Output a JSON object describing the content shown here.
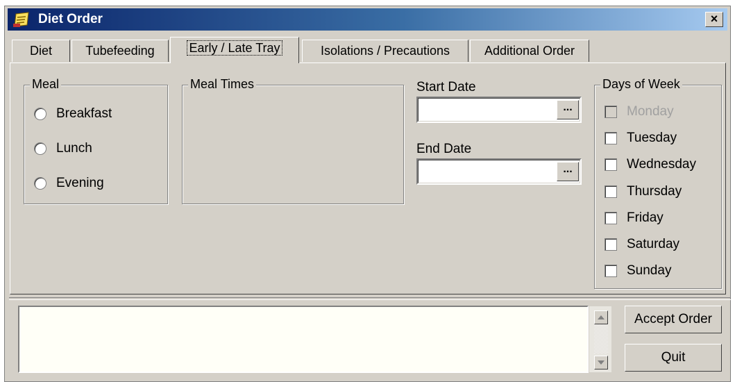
{
  "window": {
    "title": "Diet Order",
    "title_icon": "notepad-icon",
    "close_label": "×"
  },
  "tabs": [
    {
      "label": "Diet"
    },
    {
      "label": "Tubefeeding"
    },
    {
      "label": "Early / Late Tray"
    },
    {
      "label": "Isolations / Precautions"
    },
    {
      "label": "Additional Order"
    }
  ],
  "active_tab": "Early / Late Tray",
  "meal": {
    "legend": "Meal",
    "options": [
      {
        "label": "Breakfast",
        "selected": false
      },
      {
        "label": "Lunch",
        "selected": false
      },
      {
        "label": "Evening",
        "selected": false
      }
    ]
  },
  "meal_times": {
    "legend": "Meal Times"
  },
  "dates": {
    "start_label": "Start Date",
    "start_value": "",
    "end_label": "End Date",
    "end_value": "",
    "picker_label": "..."
  },
  "days_of_week": {
    "legend": "Days of Week",
    "days": [
      {
        "label": "Monday",
        "checked": false,
        "disabled": true
      },
      {
        "label": "Tuesday",
        "checked": false,
        "disabled": false
      },
      {
        "label": "Wednesday",
        "checked": false,
        "disabled": false
      },
      {
        "label": "Thursday",
        "checked": false,
        "disabled": false
      },
      {
        "label": "Friday",
        "checked": false,
        "disabled": false
      },
      {
        "label": "Saturday",
        "checked": false,
        "disabled": false
      },
      {
        "label": "Sunday",
        "checked": false,
        "disabled": false
      }
    ]
  },
  "notes": {
    "value": ""
  },
  "buttons": {
    "accept": "Accept Order",
    "quit": "Quit"
  }
}
